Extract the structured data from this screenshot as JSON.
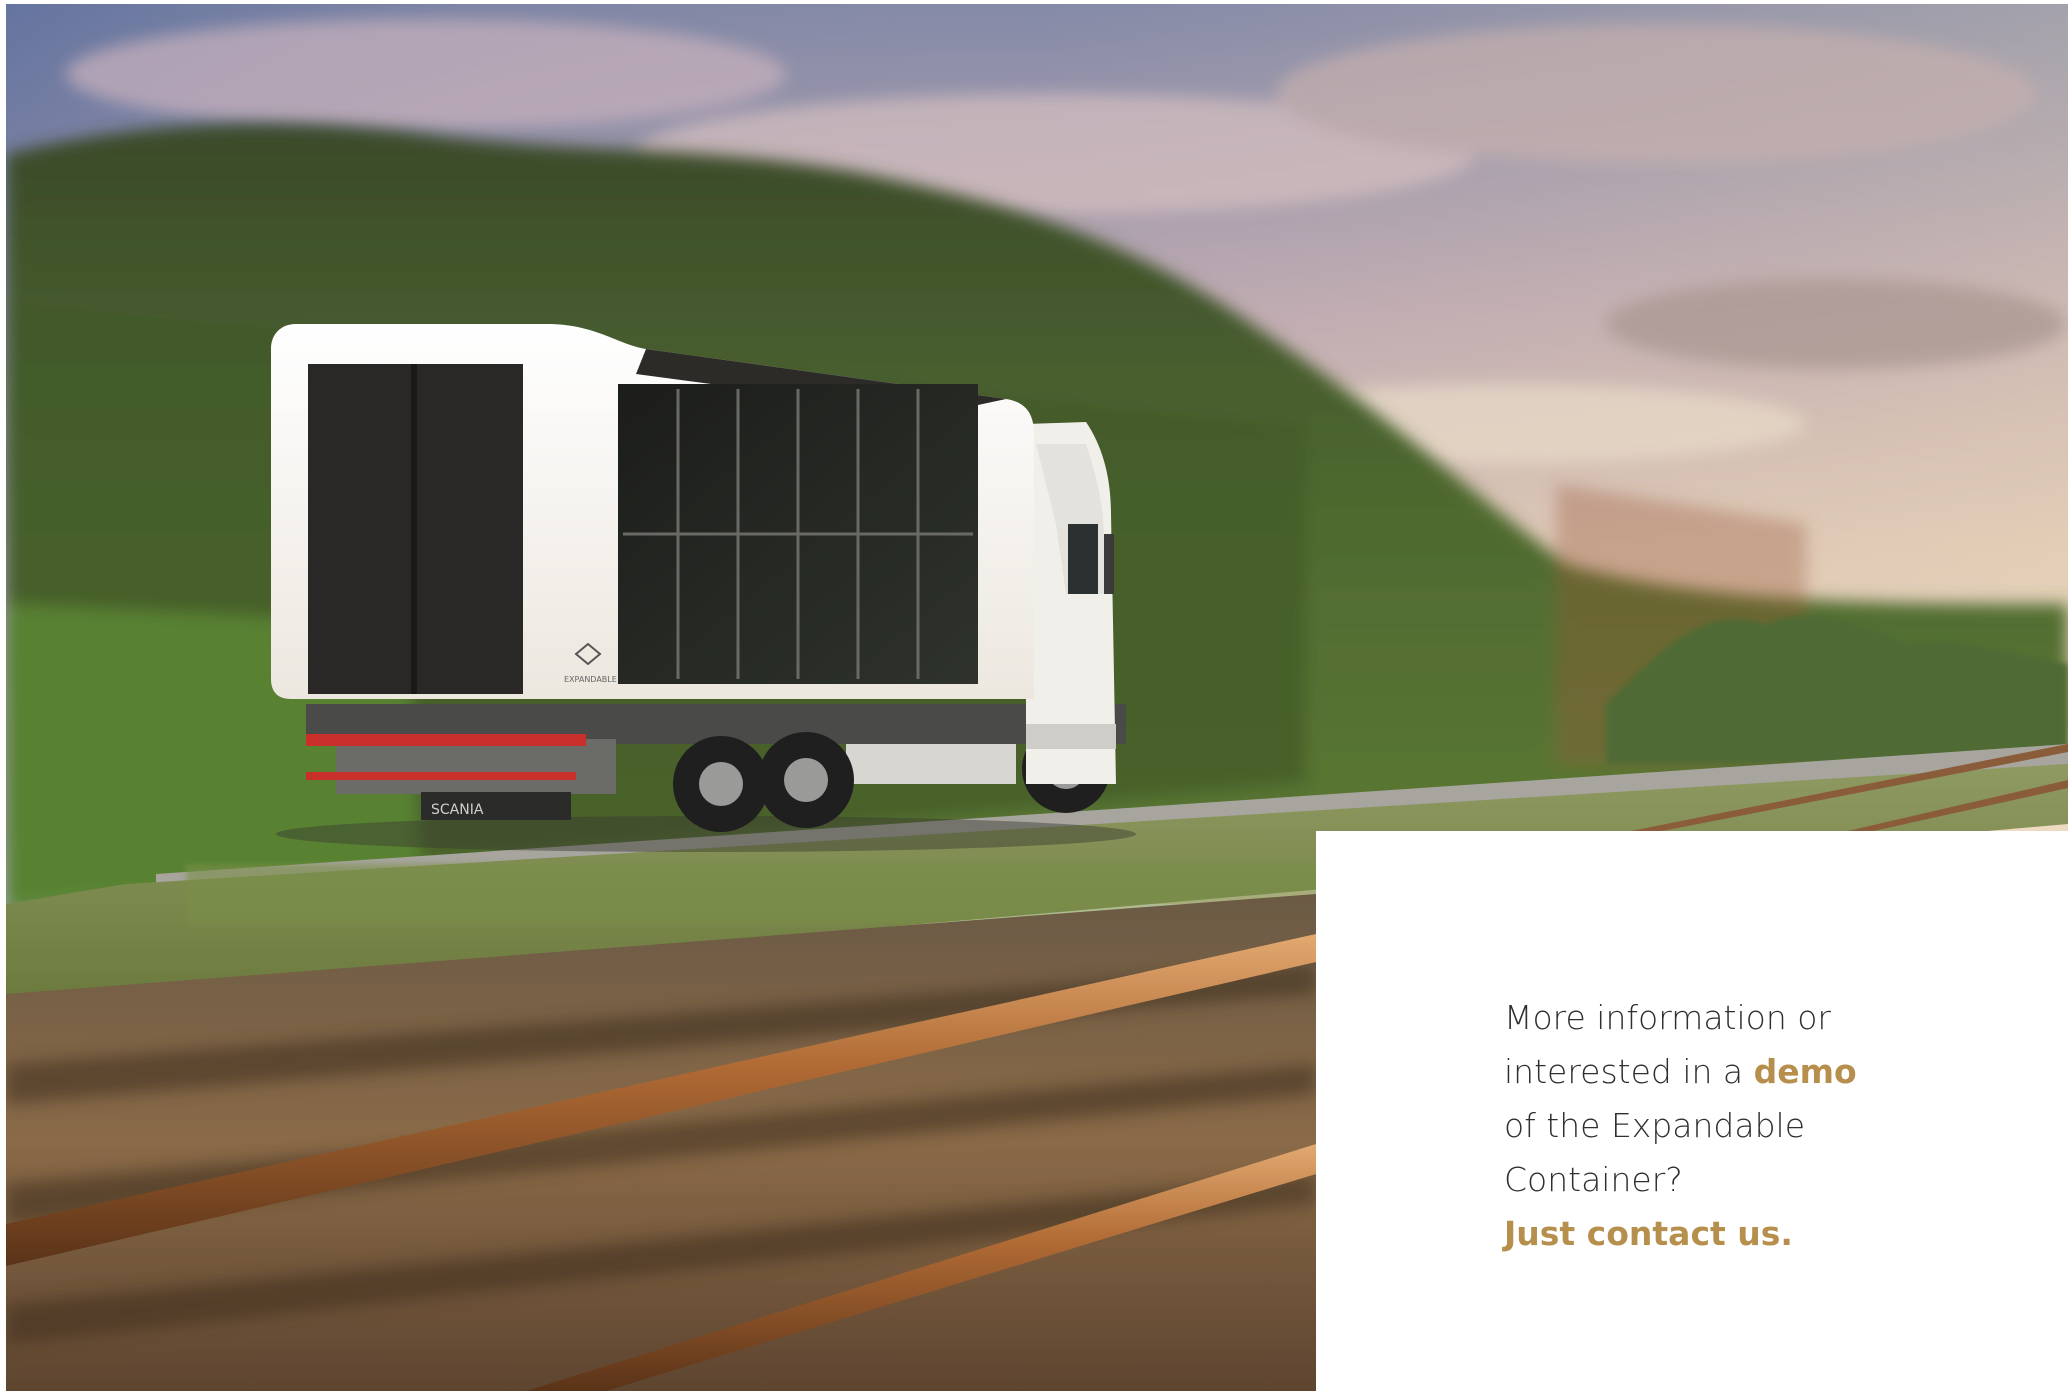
{
  "hero": {
    "image_alt": "White truck carrying an Expandable Container driving along a railway track with a motion-blurred forest in the background",
    "container_logo_text": "EXPANDABLE",
    "truck_brand_text": "SCANIA"
  },
  "info": {
    "line1": "More information or",
    "line2_prefix": "interested in a ",
    "demo_link": "demo",
    "line3": "of the Expandable",
    "line4": "Container?",
    "contact_link": "Just contact us."
  },
  "colors": {
    "accent": "#b68f4d",
    "text": "#2f2f2f",
    "background": "#ffffff"
  }
}
